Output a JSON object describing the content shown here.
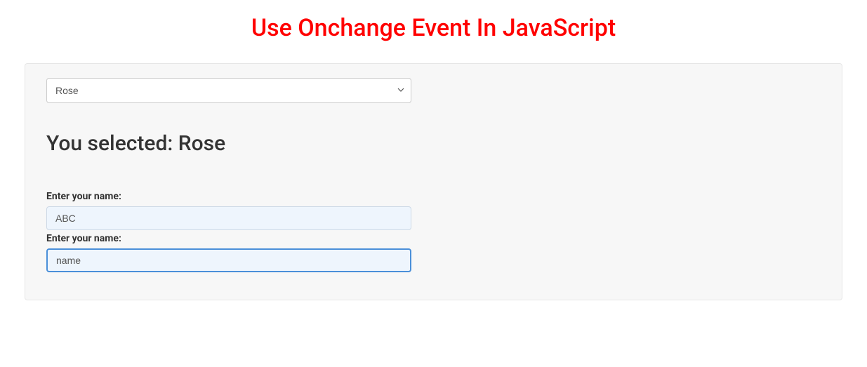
{
  "header": {
    "title": "Use Onchange Event In JavaScript"
  },
  "dropdown": {
    "selected": "Rose"
  },
  "result": {
    "prefix": "You selected: ",
    "value": "Rose"
  },
  "form": {
    "field1": {
      "label": "Enter your name:",
      "value": "ABC"
    },
    "field2": {
      "label": "Enter your name:",
      "value": "name"
    }
  }
}
